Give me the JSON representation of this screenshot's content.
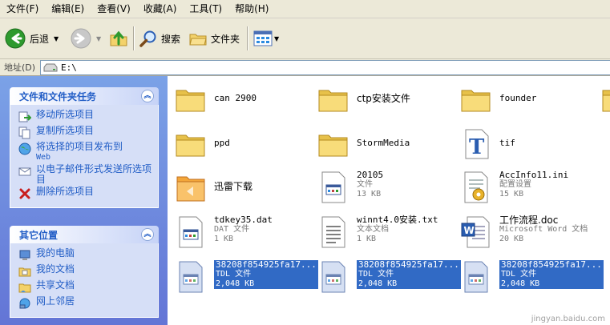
{
  "menu": [
    "文件(F)",
    "编辑(E)",
    "查看(V)",
    "收藏(A)",
    "工具(T)",
    "帮助(H)"
  ],
  "toolbar": {
    "back_label": "后退",
    "search_label": "搜索",
    "folders_label": "文件夹"
  },
  "address": {
    "label": "地址(D)",
    "value": "E:\\"
  },
  "tasks": {
    "title": "文件和文件夹任务",
    "items": [
      {
        "label": "移动所选项目"
      },
      {
        "label": "复制所选项目"
      },
      {
        "label": "将选择的项目发布到",
        "sub": "Web"
      },
      {
        "label": "以电子邮件形式发送所选项目"
      },
      {
        "label": "删除所选项目"
      }
    ]
  },
  "places": {
    "title": "其它位置",
    "items": [
      {
        "label": "我的电脑"
      },
      {
        "label": "我的文档"
      },
      {
        "label": "共享文档"
      },
      {
        "label": "网上邻居"
      }
    ]
  },
  "files": [
    {
      "name": "can 2900",
      "icon": "folder-icon"
    },
    {
      "name": "ctp安装文件",
      "icon": "folder-icon"
    },
    {
      "name": "founder",
      "icon": "folder-icon"
    },
    {
      "name": "ppd",
      "icon": "folder-icon"
    },
    {
      "name": "StormMedia",
      "icon": "folder-icon"
    },
    {
      "name": "tif",
      "icon": "font-file-icon"
    },
    {
      "name": "迅雷下载",
      "icon": "thunder-folder-icon"
    },
    {
      "name": "20105",
      "type": "文件",
      "size": "13 KB",
      "icon": "generic-file-icon"
    },
    {
      "name": "AccInfo11.ini",
      "type": "配置设置",
      "size": "15 KB",
      "icon": "ini-settings-icon"
    },
    {
      "name": "tdkey35.dat",
      "type": "DAT 文件",
      "size": "1 KB",
      "icon": "generic-file-icon"
    },
    {
      "name": "winnt4.0安装.txt",
      "type": "文本文档",
      "size": "1 KB",
      "icon": "text-file-icon"
    },
    {
      "name": "工作流程.doc",
      "type": "Microsoft Word 文档",
      "size": "20 KB",
      "icon": "word-doc-icon"
    },
    {
      "name": "38208f854925fa17...",
      "type": "TDL 文件",
      "size": "2,048 KB",
      "icon": "generic-file-icon",
      "selected": true
    },
    {
      "name": "38208f854925fa17...",
      "type": "TDL 文件",
      "size": "2,048 KB",
      "icon": "generic-file-icon",
      "selected": true
    },
    {
      "name": "38208f854925fa17...",
      "type": "TDL 文件",
      "size": "2,048 KB",
      "icon": "generic-file-icon",
      "selected": true
    }
  ],
  "watermark": "jingyan.baidu.com"
}
